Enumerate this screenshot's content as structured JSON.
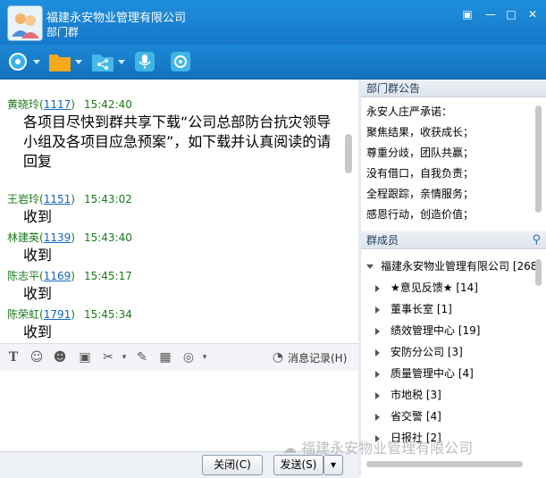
{
  "window": {
    "title": "福建永安物业管理有限公司",
    "subtitle": "部门群"
  },
  "toolbar": {
    "icons": [
      "settings-icon",
      "folder-icon",
      "share-icon",
      "microphone-icon",
      "video-icon"
    ]
  },
  "chat": {
    "messages": [
      {
        "name": "黄晓玲",
        "id": "1117",
        "time": "15:42:40",
        "text_lines": [
          "各项目尽快到群共享下载“公司总部防台抗灾领导",
          "小组及各项目应急预案”，如下载并认真阅读的请",
          "回复"
        ]
      },
      {
        "name": "王岩玲",
        "id": "1151",
        "time": "15:43:02",
        "text_lines": [
          "收到"
        ]
      },
      {
        "name": "林建英",
        "id": "1139",
        "time": "15:43:40",
        "text_lines": [
          "收到"
        ]
      },
      {
        "name": "陈志平",
        "id": "1169",
        "time": "15:45:17",
        "text_lines": [
          "收到"
        ]
      },
      {
        "name": "陈荣虹",
        "id": "1791",
        "time": "15:45:34",
        "text_lines": [
          "收到"
        ]
      }
    ]
  },
  "inputbar": {
    "history_label": "消息记录(H)"
  },
  "buttons": {
    "close": "关闭(C)",
    "send": "发送(S)"
  },
  "notice": {
    "header": "部门群公告",
    "lines": [
      "永安人庄严承诺：",
      "聚焦结果，收获成长；",
      "尊重分歧，团队共赢；",
      "没有借口，自我负责；",
      "全程跟踪，亲情服务；",
      "感恩行动，创造价值；"
    ]
  },
  "members": {
    "header": "群成员",
    "root": "福建永安物业管理有限公司 [268]",
    "groups": [
      "★意见反馈★ [14]",
      "董事长室 [1]",
      "绩效管理中心 [19]",
      "安防分公司 [3]",
      "质量管理中心 [4]",
      "市地税 [3]",
      "省交警 [4]",
      "日报社 [2]"
    ]
  },
  "watermark": "福建永安物业管理有限公司",
  "colors": {
    "titlebar": "#1578c8",
    "sender": "#1a7a1a",
    "id_link": "#1565c0"
  }
}
